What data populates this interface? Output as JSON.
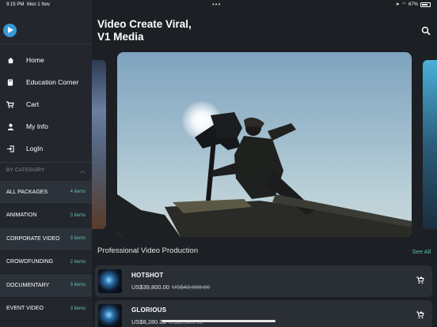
{
  "status": {
    "time": "9:15 PM",
    "date": "Mon 1 Nov",
    "battery": "67%"
  },
  "sidebar": {
    "nav": [
      {
        "label": "Home",
        "icon": "home-icon"
      },
      {
        "label": "Education Corner",
        "icon": "book-icon"
      },
      {
        "label": "Cart",
        "icon": "cart-icon"
      },
      {
        "label": "My Info",
        "icon": "person-icon"
      },
      {
        "label": "LogIn",
        "icon": "login-icon"
      }
    ],
    "category_header": "BY CATEGORY",
    "categories": [
      {
        "label": "ALL PACKAGES",
        "count": "4 items"
      },
      {
        "label": "ANIMATION",
        "count": "3 items"
      },
      {
        "label": "CORPORATE VIDEO",
        "count": "3 items"
      },
      {
        "label": "CROWDFUNDING",
        "count": "2 items"
      },
      {
        "label": "DOCUMENTARY",
        "count": "3 items"
      },
      {
        "label": "EVENT VIDEO",
        "count": "3 items"
      }
    ]
  },
  "main": {
    "title_line1": "Video Create Viral,",
    "title_line2": "V1 Media",
    "section_title": "Professional Video Production",
    "see_all": "See All",
    "products": [
      {
        "name": "HOTSHOT",
        "price": "US$39,800.00",
        "old_price": "US$42,800.00"
      },
      {
        "name": "GLORIOUS",
        "price": "US$8,280.00",
        "old_price": "US$8,880.00"
      }
    ]
  },
  "colors": {
    "accent": "#5fc3ad",
    "background": "#1c1f24",
    "sidebar": "#23272d",
    "logo": "#3a9ad9"
  }
}
